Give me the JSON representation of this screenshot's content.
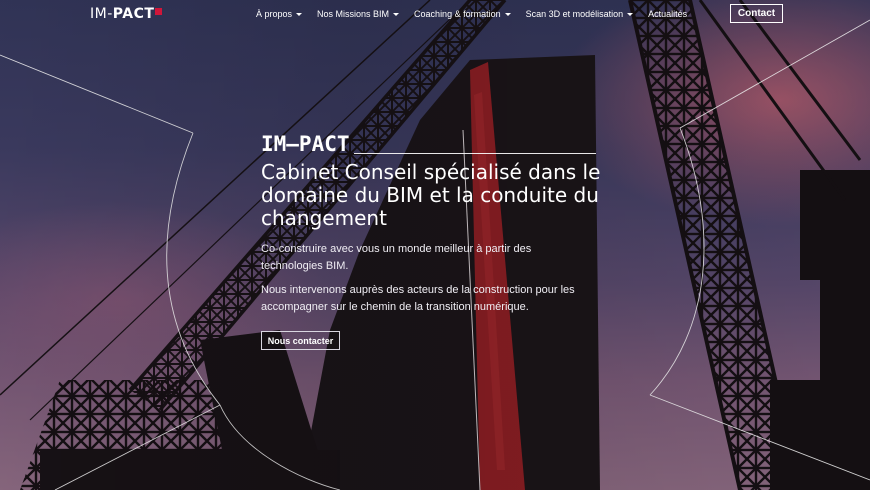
{
  "header": {
    "logo_left": "IM-",
    "logo_right": "PACT",
    "nav": [
      {
        "label": "À propos",
        "dropdown": true
      },
      {
        "label": "Nos Missions BIM",
        "dropdown": true
      },
      {
        "label": "Coaching & formation",
        "dropdown": true
      },
      {
        "label": "Scan 3D et modélisation",
        "dropdown": true
      },
      {
        "label": "Actualités",
        "dropdown": false
      }
    ],
    "contact_label": "Contact"
  },
  "hero": {
    "brand": "IM–PACT",
    "headline": "Cabinet Conseil spécialisé dans le domaine du BIM et la conduite du changement",
    "paragraph1": "Co-construire avec vous un monde meilleur à partir des technologies BIM.",
    "paragraph2": "Nous intervenons auprès des acteurs de la construction pour les accompagner sur le chemin de la transition numérique.",
    "cta_label": "Nous contacter"
  },
  "colors": {
    "accent": "#d0163a",
    "sky_top": "#33365a",
    "sky_bottom": "#8c6a82",
    "silhouette": "#1a1418"
  }
}
